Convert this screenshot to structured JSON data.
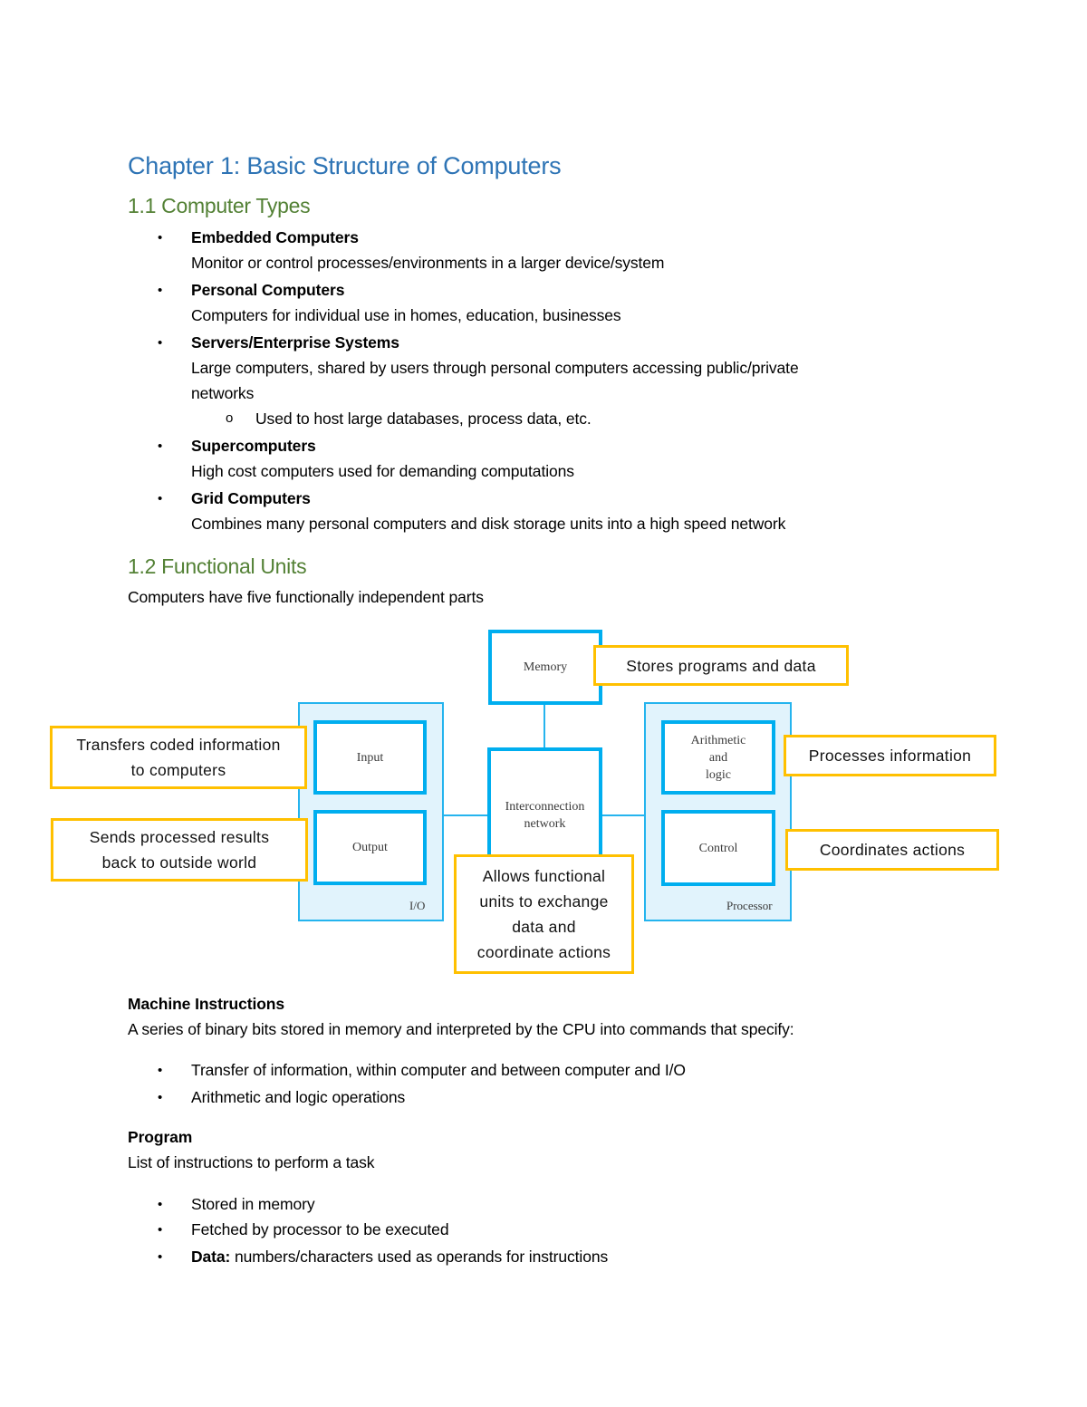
{
  "chapter_title": "Chapter 1: Basic Structure of Computers",
  "section_1": {
    "heading": "1.1 Computer Types",
    "items": [
      {
        "title": "Embedded Computers",
        "desc": "Monitor or control processes/environments in a larger device/system"
      },
      {
        "title": "Personal Computers",
        "desc": "Computers for individual use in homes, education, businesses"
      },
      {
        "title": "Servers/Enterprise Systems",
        "desc": "Large computers, shared by users through personal computers accessing public/private",
        "desc2": "networks",
        "sub_bullet": "Used to host large databases, process data, etc."
      },
      {
        "title": "Supercomputers",
        "desc": "High cost computers used for demanding computations"
      },
      {
        "title": "Grid Computers",
        "desc": "Combines many personal computers and disk storage units into a high speed network"
      }
    ]
  },
  "section_2": {
    "heading": "1.2 Functional Units",
    "intro": "Computers have five functionally independent parts"
  },
  "diagram": {
    "units": {
      "memory": "Memory",
      "input": "Input",
      "output": "Output",
      "interconnect_1": "Interconnection",
      "interconnect_2": "network",
      "alu_1": "Arithmetic",
      "alu_2": "and",
      "alu_3": "logic",
      "control": "Control"
    },
    "groups": {
      "io": "I/O",
      "processor": "Processor"
    },
    "callouts": {
      "memory": "Stores programs and data",
      "input_1": "Transfers coded information",
      "input_2": "to computers",
      "output_1": "Sends processed results",
      "output_2": "back to outside world",
      "interconnect_1": "Allows functional",
      "interconnect_2": "units to exchange",
      "interconnect_3": "data and",
      "interconnect_4": "coordinate actions",
      "alu": "Processes information",
      "control": "Coordinates actions"
    }
  },
  "machine_instructions": {
    "heading": "Machine Instructions",
    "desc": "A series of binary bits stored in memory and interpreted by the CPU into commands that specify:",
    "items": [
      "Transfer of information, within computer and between computer and I/O",
      "Arithmetic and logic operations"
    ]
  },
  "program": {
    "heading": "Program",
    "desc": "List of instructions to perform a task",
    "items": [
      "Stored in memory",
      "Fetched by processor to be executed"
    ],
    "data_label": "Data:",
    "data_desc": " numbers/characters used as operands for instructions"
  },
  "bullet_char": "•",
  "sub_bullet_char": "o"
}
